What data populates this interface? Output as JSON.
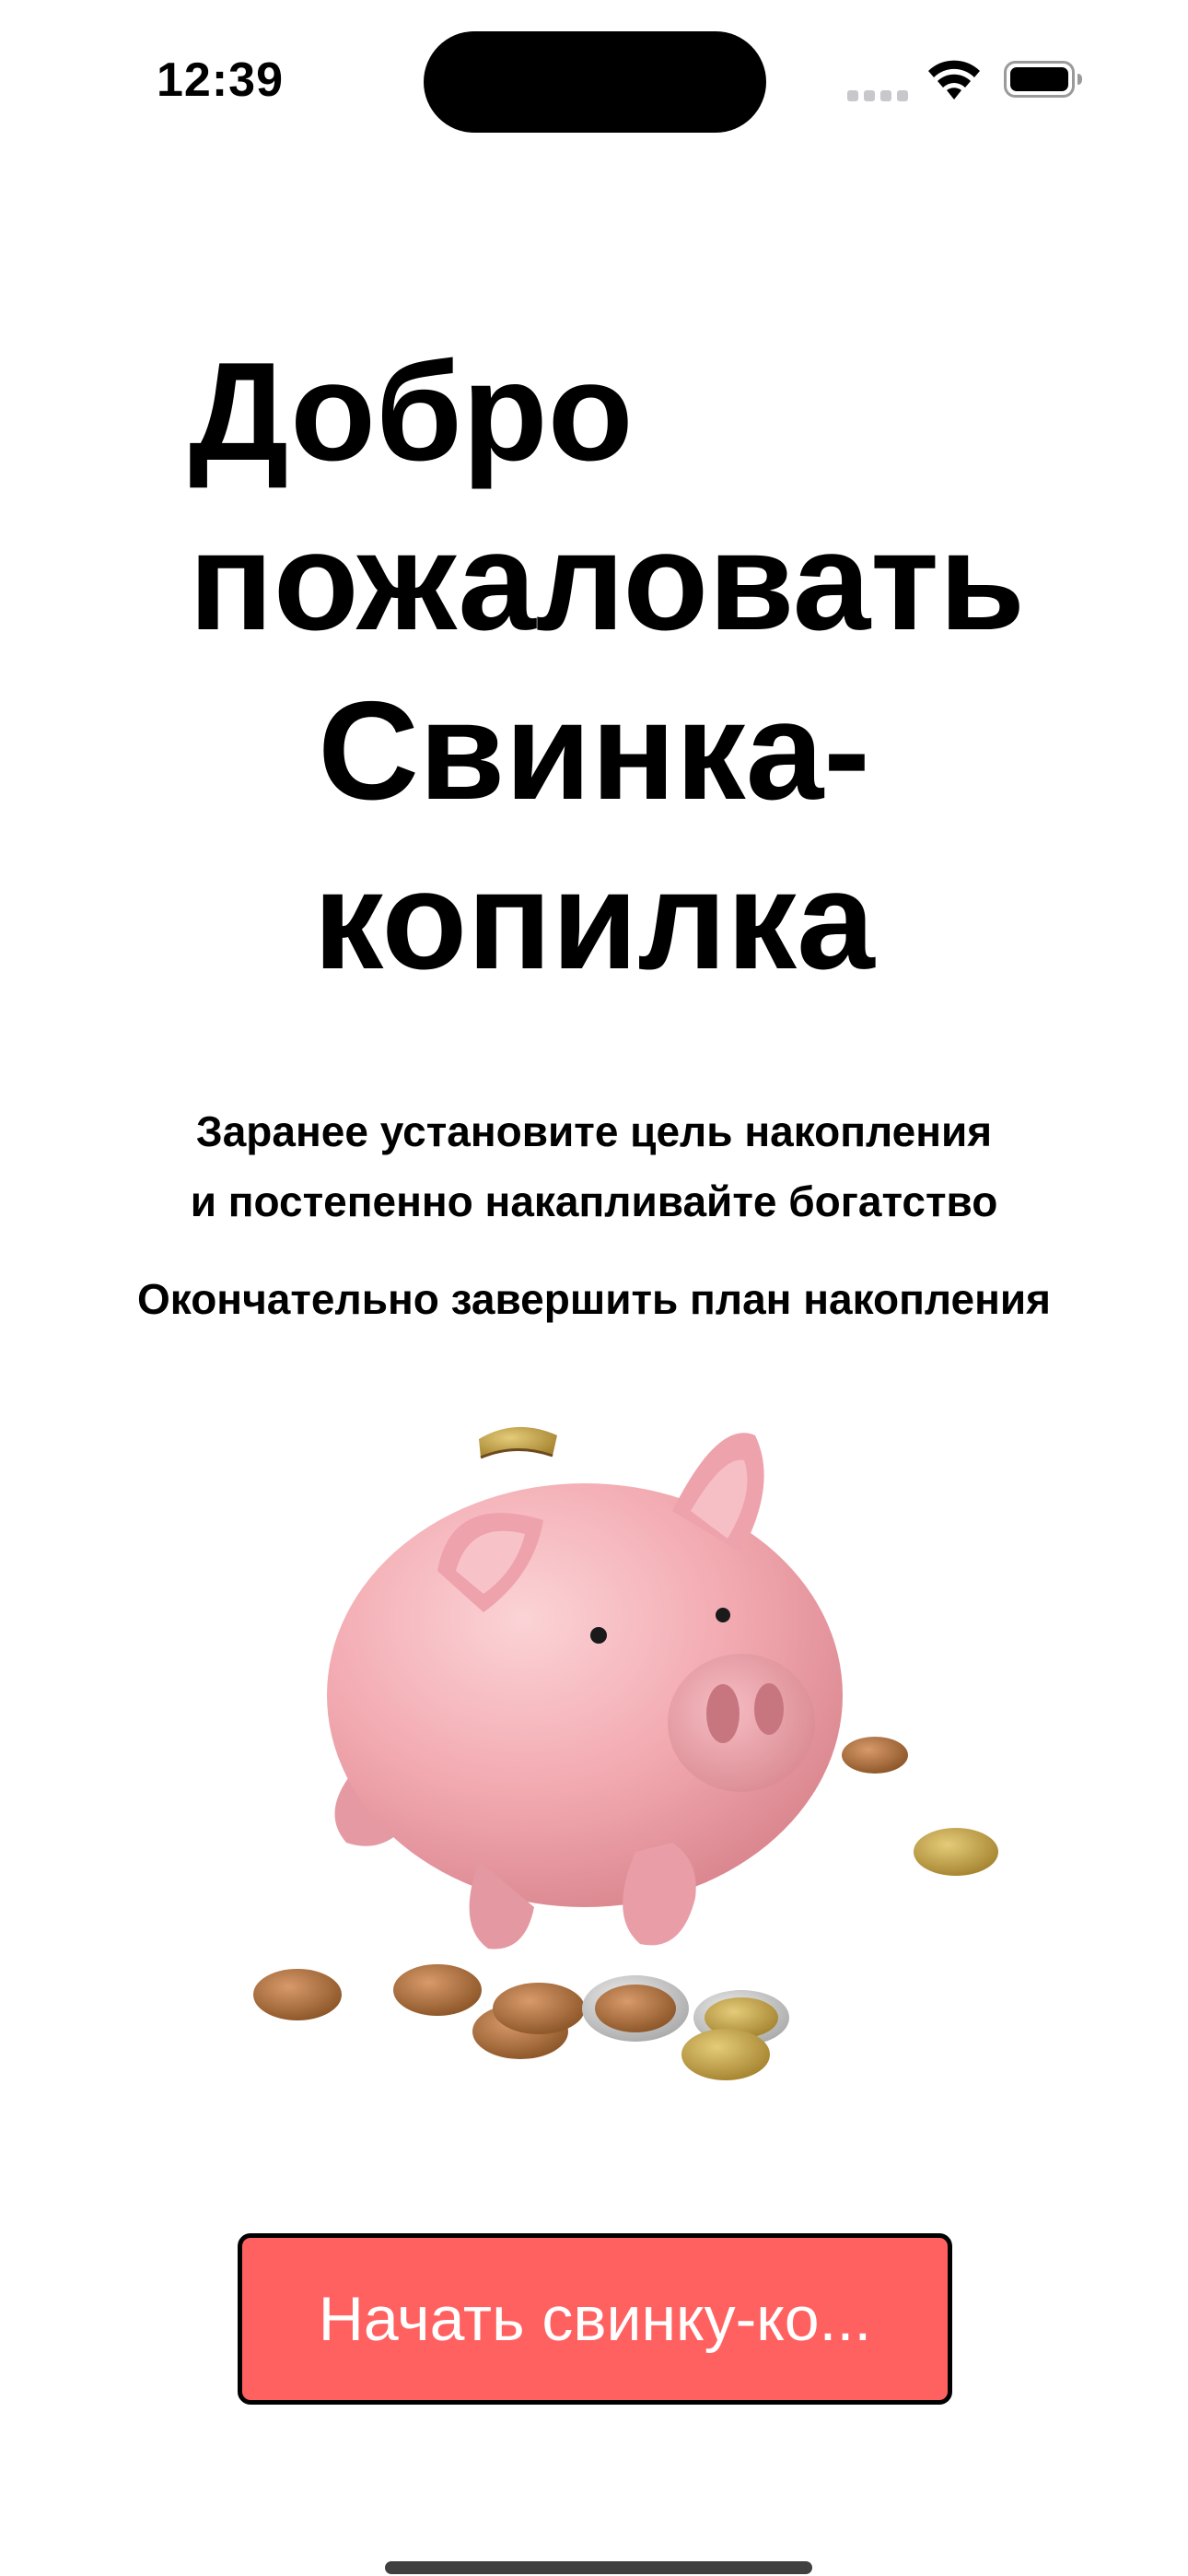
{
  "status_bar": {
    "time": "12:39",
    "icons": [
      "cellular-signal-icon",
      "wifi-icon",
      "battery-icon"
    ]
  },
  "title": {
    "line1": "Добро",
    "line2": "пожаловать",
    "line3": "Свинка-",
    "line4": "копилка"
  },
  "description": {
    "line1": "Заранее установите цель накопления",
    "line2": "и постепенно накапливайте богатство",
    "line3": "Окончательно завершить план накопления"
  },
  "illustration": {
    "name": "piggy-bank-with-coins"
  },
  "start_button": {
    "label": "Начать свинку-ко..."
  },
  "colors": {
    "accent": "#ff6161",
    "background": "#ffffff",
    "text": "#000000",
    "button_text": "#ffffff"
  }
}
